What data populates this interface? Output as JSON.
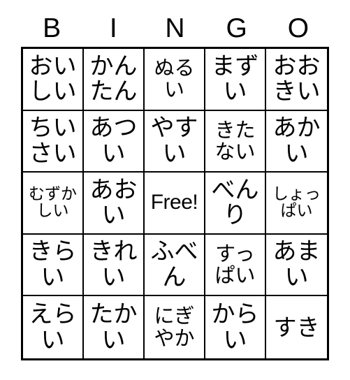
{
  "header": {
    "letters": [
      "B",
      "I",
      "N",
      "G",
      "O"
    ]
  },
  "grid": {
    "rows": 5,
    "columns": 5,
    "free_space": {
      "row": 2,
      "column": 2,
      "label": "Free!"
    },
    "cells": [
      [
        {
          "text": "おいしい",
          "size": "xl"
        },
        {
          "text": "かんたん",
          "size": "xl"
        },
        {
          "text": "ぬるい",
          "size": "md"
        },
        {
          "text": "まずい",
          "size": "xl"
        },
        {
          "text": "おおきい",
          "size": "xl"
        }
      ],
      [
        {
          "text": "ちいさい",
          "size": "xl"
        },
        {
          "text": "あつい",
          "size": "xl"
        },
        {
          "text": "やすい",
          "size": "xl"
        },
        {
          "text": "きたない",
          "size": "md"
        },
        {
          "text": "あかい",
          "size": "xl"
        }
      ],
      [
        {
          "text": "むずかしい",
          "size": "sm"
        },
        {
          "text": "あおい",
          "size": "xl"
        },
        {
          "text": "Free!",
          "size": "free"
        },
        {
          "text": "べんり",
          "size": "xl"
        },
        {
          "text": "しょっぱい",
          "size": "sm"
        }
      ],
      [
        {
          "text": "きらい",
          "size": "xl"
        },
        {
          "text": "きれい",
          "size": "xl"
        },
        {
          "text": "ふべん",
          "size": "xl"
        },
        {
          "text": "すっぱい",
          "size": "md"
        },
        {
          "text": "あまい",
          "size": "xl"
        }
      ],
      [
        {
          "text": "えらい",
          "size": "xl"
        },
        {
          "text": "たかい",
          "size": "xl"
        },
        {
          "text": "にぎやか",
          "size": "md"
        },
        {
          "text": "からい",
          "size": "xl"
        },
        {
          "text": "すき",
          "size": "lg"
        }
      ]
    ]
  },
  "colors": {
    "background": "#ffffff",
    "ink": "#000000",
    "grid_line": "#000000"
  }
}
